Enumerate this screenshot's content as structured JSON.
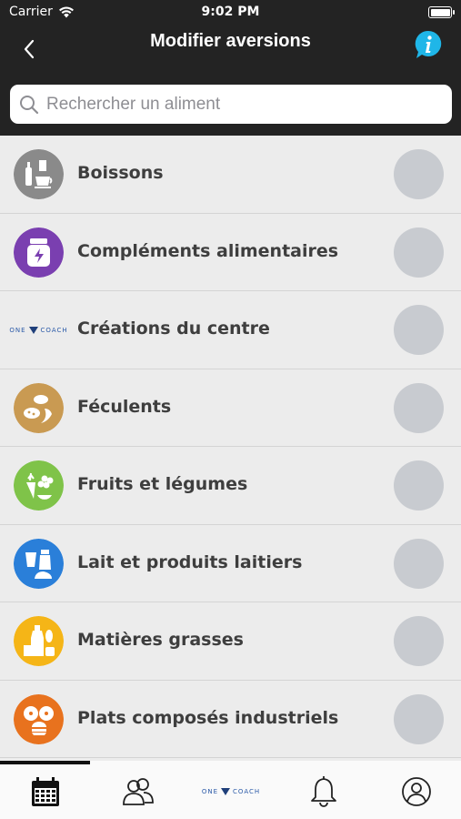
{
  "status_bar": {
    "carrier": "Carrier",
    "time": "9:02 PM"
  },
  "nav": {
    "title": "Modifier aversions",
    "back_icon": "chevron-left-icon",
    "info_icon": "info-icon"
  },
  "search": {
    "placeholder": "Rechercher un aliment",
    "value": ""
  },
  "categories": [
    {
      "label": "Boissons",
      "icon": "drinks-icon",
      "color": "#8a8a8a",
      "selected": false
    },
    {
      "label": "Compléments alimentaires",
      "icon": "supplement-jar-icon",
      "color": "#7a3fb0",
      "selected": false
    },
    {
      "label": "Créations du centre",
      "icon": "onecoach-logo",
      "color": "#ececec",
      "selected": false,
      "brand_left": "ONE",
      "brand_right": "COACH"
    },
    {
      "label": "Féculents",
      "icon": "bread-grains-icon",
      "color": "#c99a52",
      "selected": false
    },
    {
      "label": "Fruits et légumes",
      "icon": "fruits-vegetables-icon",
      "color": "#7fc349",
      "selected": false
    },
    {
      "label": "Lait et produits laitiers",
      "icon": "dairy-icon",
      "color": "#2a7fd9",
      "selected": false
    },
    {
      "label": "Matières grasses",
      "icon": "oils-fats-icon",
      "color": "#f5b517",
      "selected": false
    },
    {
      "label": "Plats composés industriels",
      "icon": "prepared-meals-icon",
      "color": "#e8721e",
      "selected": false
    }
  ],
  "toggle_color": "#c8cbd0",
  "tab_bar": {
    "tabs": [
      {
        "name": "calendar-icon",
        "active": true
      },
      {
        "name": "users-group-icon",
        "active": false
      },
      {
        "name": "onecoach-logo",
        "active": false,
        "brand_left": "ONE",
        "brand_right": "COACH"
      },
      {
        "name": "bell-icon",
        "active": false
      },
      {
        "name": "profile-icon",
        "active": false
      }
    ]
  }
}
